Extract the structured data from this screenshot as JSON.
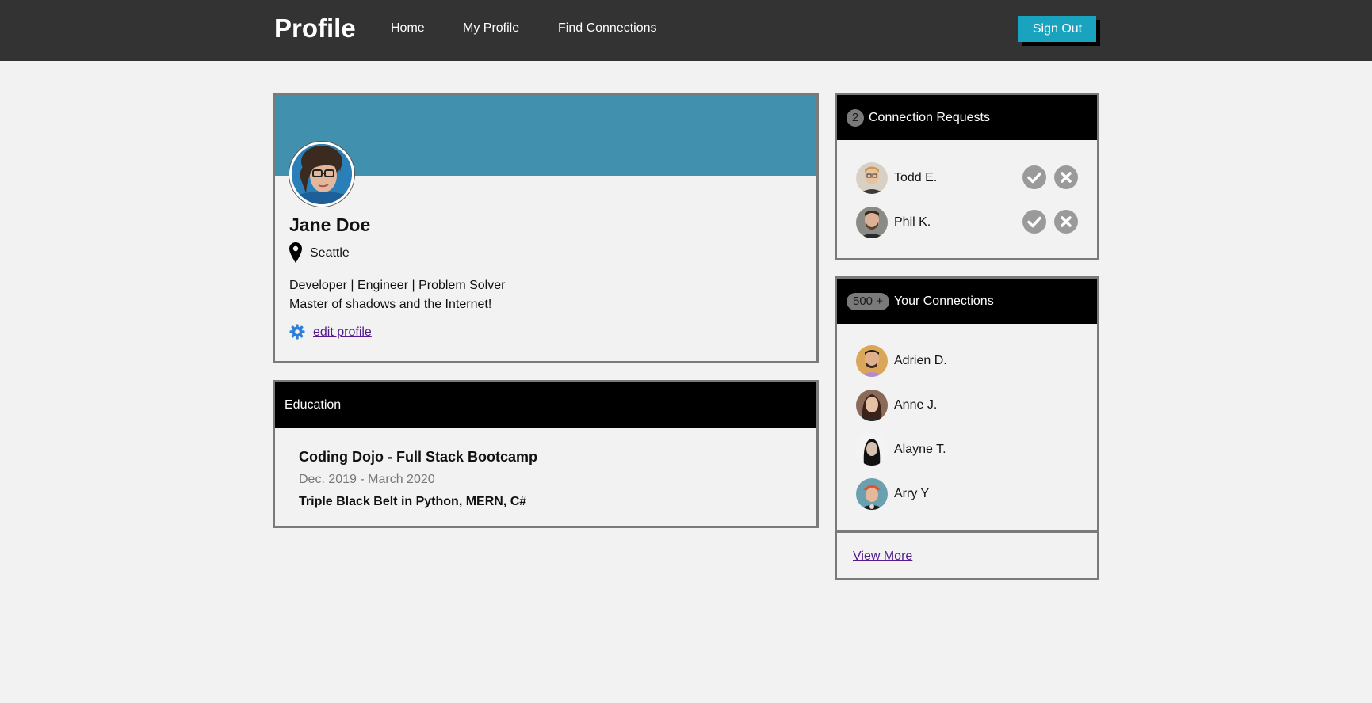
{
  "navbar": {
    "brand": "Profile",
    "links": [
      "Home",
      "My Profile",
      "Find Connections"
    ],
    "sign_out": "Sign Out"
  },
  "profile": {
    "name": "Jane Doe",
    "location": "Seattle",
    "bio_line1": "Developer | Engineer | Problem Solver",
    "bio_line2": "Master of shadows and the Internet!",
    "edit_link": "edit profile",
    "banner_color": "#4190ae"
  },
  "education": {
    "header": "Education",
    "title": "Coding Dojo - Full Stack Bootcamp",
    "dates": "Dec. 2019 - March 2020",
    "detail": "Triple Black Belt in Python, MERN, C#"
  },
  "requests": {
    "count": "2",
    "header": "Connection Requests",
    "people": [
      {
        "name": "Todd E.",
        "accept_icon": "check-icon",
        "reject_icon": "close-icon"
      },
      {
        "name": "Phil K.",
        "accept_icon": "check-icon",
        "reject_icon": "close-icon"
      }
    ]
  },
  "connections": {
    "count": "500 +",
    "header": "Your Connections",
    "people": [
      {
        "name": "Adrien D."
      },
      {
        "name": "Anne J."
      },
      {
        "name": "Alayne T."
      },
      {
        "name": "Arry Y"
      }
    ],
    "view_more": "View More"
  },
  "colors": {
    "navbar": "#333333",
    "accent": "#1aa3be",
    "card_header": "#000000",
    "link": "#551a8b",
    "gear": "#2f7fd8"
  }
}
